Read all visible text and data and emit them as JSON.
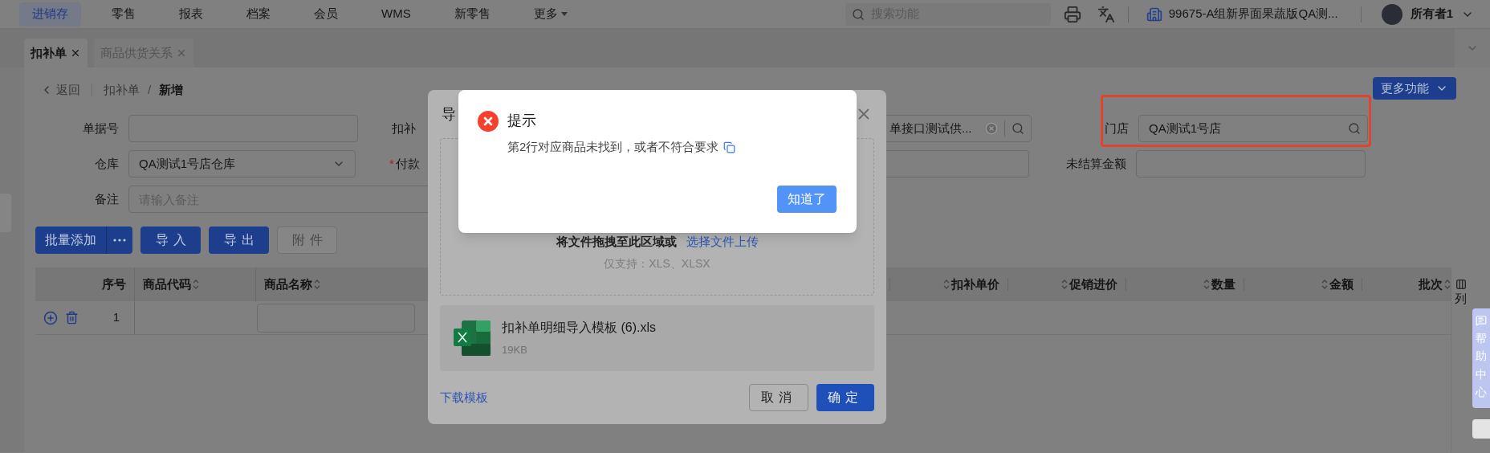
{
  "top_nav": {
    "items": [
      {
        "label": "进销存",
        "selected": true,
        "dropdown": false
      },
      {
        "label": "零售",
        "selected": false,
        "dropdown": false
      },
      {
        "label": "报表",
        "selected": false,
        "dropdown": false
      },
      {
        "label": "档案",
        "selected": false,
        "dropdown": false
      },
      {
        "label": "会员",
        "selected": false,
        "dropdown": false
      },
      {
        "label": "WMS",
        "selected": false,
        "dropdown": false
      },
      {
        "label": "新零售",
        "selected": false,
        "dropdown": false
      },
      {
        "label": "更多",
        "selected": false,
        "dropdown": true
      }
    ],
    "search": {
      "placeholder": "搜索功能"
    },
    "account": {
      "company": "99675-A组新界面果蔬版QA测...",
      "user": "所有者1"
    }
  },
  "tabs": [
    {
      "label": "扣补单",
      "selected": true
    },
    {
      "label": "商品供货关系",
      "selected": false
    }
  ],
  "breadcrumb": {
    "back": "返回",
    "items": [
      "扣补单",
      "新增"
    ],
    "separator": "/"
  },
  "more_button": "更多功能",
  "form": {
    "required_symbol": "*",
    "rows": [
      [
        {
          "kind": "text",
          "label": "单据号",
          "required": false
        },
        {
          "kind": "covered",
          "label": "扣补",
          "required": false
        },
        {
          "kind": "search",
          "value": "单接口测试供...",
          "clearable": true,
          "highlighted": false
        },
        {
          "kind": "search",
          "label": "门店",
          "value": "QA测试1号店",
          "clearable": false,
          "required": false,
          "highlighted": true
        }
      ],
      [
        {
          "kind": "select",
          "label": "仓库",
          "value": "QA测试1号店仓库",
          "required": false
        },
        {
          "kind": "covered",
          "label": "付款",
          "required": true
        },
        {
          "kind": "text"
        },
        {
          "kind": "text",
          "label": "未结算金额",
          "required": false
        }
      ],
      [
        {
          "kind": "textarea",
          "label": "备注",
          "placeholder": "请输入备注",
          "required": false
        }
      ]
    ]
  },
  "actions": [
    {
      "label": "批量添加",
      "kind": "split",
      "disabled": false
    },
    {
      "label": "导入",
      "kind": "plain",
      "disabled": false
    },
    {
      "label": "导出",
      "kind": "plain",
      "disabled": false
    },
    {
      "label": "附件",
      "kind": "plain",
      "disabled": true
    }
  ],
  "table": {
    "columns": [
      {
        "label": "序号",
        "kind": "index",
        "sortable": false
      },
      {
        "label": "商品代码",
        "kind": "text",
        "sortable": true
      },
      {
        "label": "商品名称",
        "kind": "text",
        "sortable": true
      },
      {
        "label": "扣补单价",
        "kind": "number",
        "sortable": true
      },
      {
        "label": "促销进价",
        "kind": "number",
        "sortable": true
      },
      {
        "label": "数量",
        "kind": "number",
        "sortable": true
      },
      {
        "label": "金额",
        "kind": "number",
        "sortable": true
      },
      {
        "label": "批次",
        "kind": "text",
        "sortable": true
      }
    ],
    "rows": [
      {
        "index": "1"
      }
    ],
    "column_settings": "列"
  },
  "help_tab": "帮助中心",
  "import_dialog": {
    "title": "导",
    "drop_text": "将文件拖拽至此区域或",
    "drop_link": "选择文件上传",
    "formats": "仅支持：XLS、XLSX",
    "file": {
      "name": "扣补单明细导入模板 (6).xls",
      "size": "19KB"
    },
    "template_link": "下载模板",
    "buttons": [
      {
        "label": "取消",
        "primary": false
      },
      {
        "label": "确定",
        "primary": true
      }
    ]
  },
  "alert": {
    "kind": "error",
    "title": "提示",
    "message": "第2行对应商品未找到，或者不符合要求",
    "button": "知道了"
  }
}
